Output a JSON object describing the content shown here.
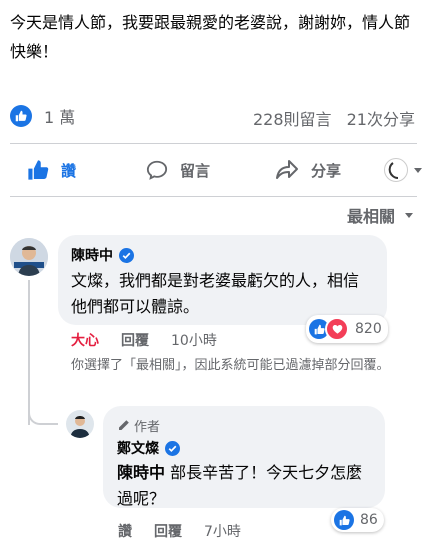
{
  "post": {
    "text": "今天是情人節，我要跟最親愛的老婆說，謝謝妳，情人節快樂！",
    "reaction_count": "1 萬",
    "comments_count": "228則留言",
    "shares_count": "21次分享"
  },
  "actions": {
    "like": "讚",
    "comment": "留言",
    "share": "分享"
  },
  "sort_label": "最相關",
  "comment": {
    "author": "陳時中",
    "text": "文燦，我們都是對老婆最虧欠的人，相信他們都可以體諒。",
    "reaction_label": "大心",
    "reply_label": "回覆",
    "time": "10小時",
    "reaction_count": "820",
    "filter_note": "你選擇了「最相關」，因此系統可能已過濾掉部分回覆。"
  },
  "reply": {
    "author_badge": "作者",
    "author": "鄭文燦",
    "mention": "陳時中",
    "text": " 部長辛苦了！今天七夕怎麼過呢？",
    "like_label": "讚",
    "reply_label": "回覆",
    "time": "7小時",
    "reaction_count": "86"
  },
  "colors": {
    "facebook_blue": "#1b74e4",
    "love_red": "#f33e58",
    "reaction_red": "#e41e3f",
    "secondary_text": "#65676b",
    "bubble_bg": "#f0f2f5"
  }
}
